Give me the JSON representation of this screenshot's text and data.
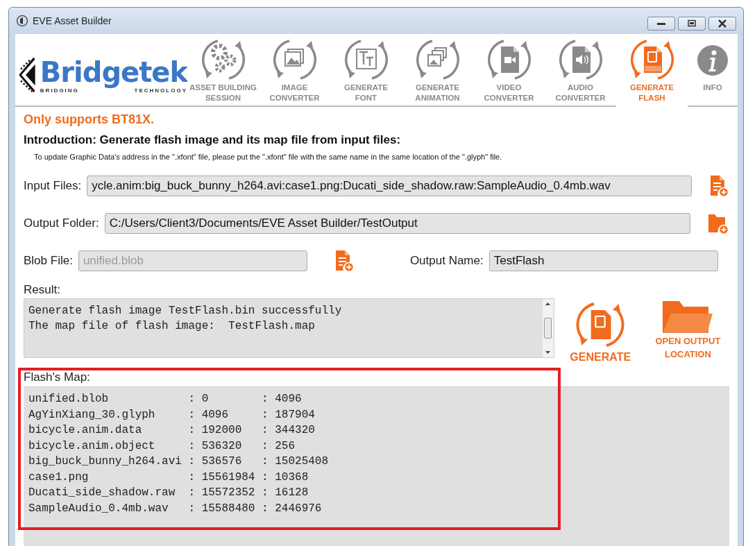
{
  "window": {
    "title": "EVE Asset Builder"
  },
  "logo": {
    "name": "Bridgetek",
    "tagline_left": "BRIDGING",
    "tagline_right": "TECHNOLOGY"
  },
  "tabs": [
    {
      "kind": "gears",
      "lines": [
        "ASSET BUILDING",
        "SESSION"
      ],
      "selected": false
    },
    {
      "kind": "image",
      "lines": [
        "IMAGE",
        "CONVERTER"
      ],
      "selected": false
    },
    {
      "kind": "font",
      "lines": [
        "GENERATE",
        "FONT"
      ],
      "selected": false
    },
    {
      "kind": "animation",
      "lines": [
        "GENERATE",
        "ANIMATION"
      ],
      "selected": false
    },
    {
      "kind": "video",
      "lines": [
        "VIDEO",
        "CONVERTER"
      ],
      "selected": false
    },
    {
      "kind": "audio",
      "lines": [
        "AUDIO",
        "CONVERTER"
      ],
      "selected": false
    },
    {
      "kind": "flash",
      "lines": [
        "GENERATE",
        "FLASH"
      ],
      "selected": true
    },
    {
      "kind": "info",
      "lines": [
        "INFO"
      ],
      "selected": false
    }
  ],
  "notice": "Only supports BT81X.",
  "introduction": "Introduction: Generate flash image and its map file from input files:",
  "hint": "To update Graphic Data's address in the \".xfont\" file, please put the \".xfont\" file with the same name in the same location of the \".glyph\" file.",
  "input_files": {
    "label": "Input Files:",
    "value": "ycle.anim:big_buck_bunny_h264.avi:case1.png:Ducati_side_shadow.raw:SampleAudio_0.4mb.wav"
  },
  "output_folder": {
    "label": "Output Folder:",
    "value": "C:/Users/Client3/Documents/EVE Asset Builder/TestOutput"
  },
  "blob_file": {
    "label": "Blob File:",
    "placeholder": "unified.blob"
  },
  "output_name": {
    "label": "Output Name:",
    "value": "TestFlash"
  },
  "result": {
    "label": "Result:",
    "lines": [
      "Generate flash image TestFlash.bin successfully",
      "The map file of flash image:  TestFlash.map"
    ]
  },
  "generate_button": "GENERATE",
  "open_output_button": [
    "OPEN OUTPUT",
    "LOCATION"
  ],
  "flash_map": {
    "label": "Flash's Map:",
    "lines": [
      "unified.blob            : 0        : 4096",
      "AgYinXiang_30.glyph     : 4096     : 187904",
      "bicycle.anim.data       : 192000   : 344320",
      "bicycle.anim.object     : 536320   : 256",
      "big_buck_bunny_h264.avi : 536576   : 15025408",
      "case1.png               : 15561984 : 10368",
      "Ducati_side_shadow.raw  : 15572352 : 16128",
      "SampleAudio_0.4mb.wav   : 15588480 : 2446976"
    ]
  }
}
